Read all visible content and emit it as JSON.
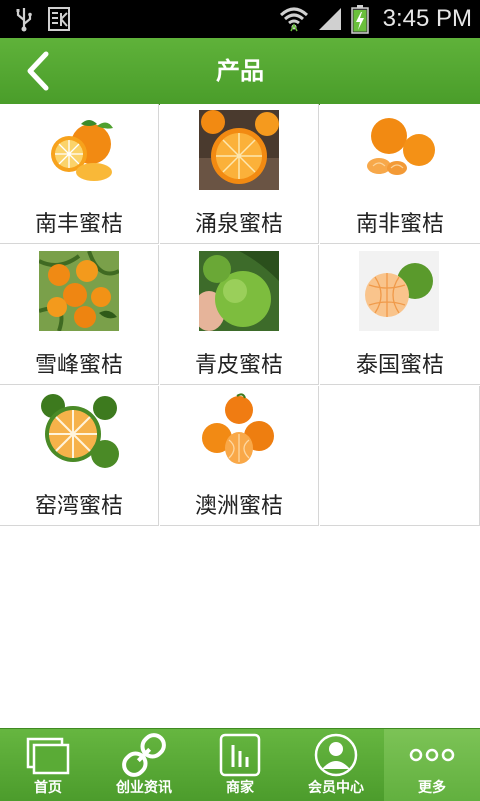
{
  "status_bar": {
    "time": "3:45 PM"
  },
  "header": {
    "title": "产品"
  },
  "products": [
    {
      "label": "南丰蜜桔",
      "image": "oranges-with-leaves"
    },
    {
      "label": "涌泉蜜桔",
      "image": "halved-orange-on-wood"
    },
    {
      "label": "南非蜜桔",
      "image": "oranges-and-segments"
    },
    {
      "label": "雪峰蜜桔",
      "image": "oranges-on-tree"
    },
    {
      "label": "青皮蜜桔",
      "image": "green-tangerine-in-hand"
    },
    {
      "label": "泰国蜜桔",
      "image": "peeled-tangerine"
    },
    {
      "label": "窑湾蜜桔",
      "image": "green-halved-tangerine"
    },
    {
      "label": "澳洲蜜桔",
      "image": "stacked-mandarins"
    }
  ],
  "tabbar": {
    "items": [
      {
        "label": "首页",
        "icon": "home-pages-icon"
      },
      {
        "label": "创业资讯",
        "icon": "link-icon"
      },
      {
        "label": "商家",
        "icon": "bar-chart-icon"
      },
      {
        "label": "会员中心",
        "icon": "member-icon"
      },
      {
        "label": "更多",
        "icon": "more-dots-icon"
      }
    ],
    "active_index": 4
  },
  "colors": {
    "brand_green": "#55a832",
    "status_bar": "#000000"
  }
}
